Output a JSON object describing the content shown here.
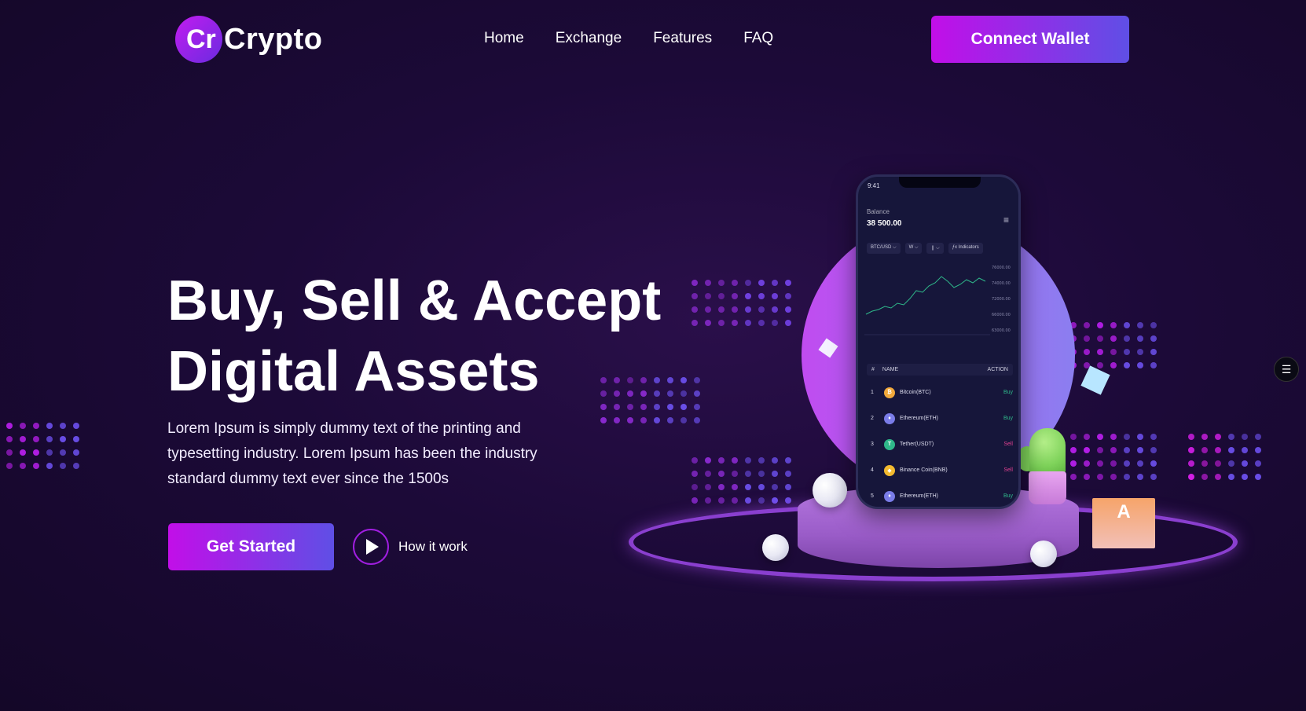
{
  "header": {
    "logo_mark": "Cr",
    "logo_text": "Crypto",
    "nav": [
      "Home",
      "Exchange",
      "Features",
      "FAQ"
    ],
    "connect_label": "Connect Wallet"
  },
  "hero": {
    "title_line1": "Buy, Sell & Accept",
    "title_line2": "Digital Assets",
    "description": "Lorem Ipsum is simply dummy text of the printing and typesetting industry. Lorem Ipsum has been the industry standard dummy text ever since the 1500s",
    "cta_label": "Get Started",
    "secondary_label": "How it work"
  },
  "phone": {
    "time": "9:41",
    "balance_label": "Balance",
    "balance_value": "38 500.00",
    "controls": [
      "BTC/USD ⌵",
      "W ⌵",
      "❙ ⌵",
      "ƒx Indicators"
    ],
    "table_headers": [
      "#",
      "NAME",
      "ACTION"
    ],
    "rows": [
      {
        "num": "1",
        "name": "Bitcoin(BTC)",
        "action": "Buy",
        "coin_color": "#f2a93b",
        "symbol": "₿"
      },
      {
        "num": "2",
        "name": "Ethereum(ETH)",
        "action": "Buy",
        "coin_color": "#7a7ce8",
        "symbol": "♦"
      },
      {
        "num": "3",
        "name": "Tether(USDT)",
        "action": "Sell",
        "coin_color": "#2fb88a",
        "symbol": "T"
      },
      {
        "num": "4",
        "name": "Binance Coin(BNB)",
        "action": "Sell",
        "coin_color": "#f3ba2f",
        "symbol": "◆"
      },
      {
        "num": "5",
        "name": "Ethereum(ETH)",
        "action": "Buy",
        "coin_color": "#7a7ce8",
        "symbol": "♦"
      }
    ]
  },
  "colors": {
    "accent_start": "#c20ee8",
    "accent_end": "#5f4fe6",
    "buy": "#2fb88a",
    "sell": "#e04090"
  }
}
